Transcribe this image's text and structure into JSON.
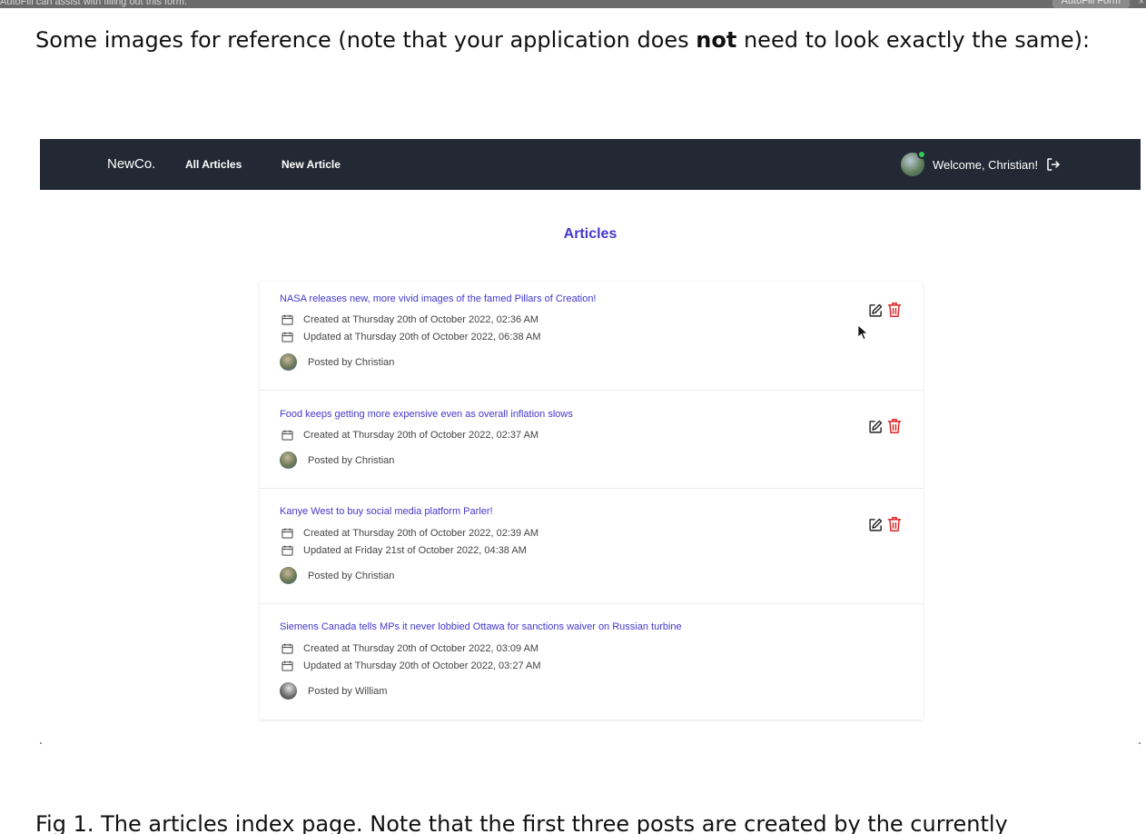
{
  "autofill": {
    "message": "AutoFill can assist with filling out this form.",
    "button_label": "AutoFill Form",
    "close_label": "×"
  },
  "document": {
    "intro_prefix": "Some images for reference (note that your application does ",
    "intro_bold": "not",
    "intro_suffix": " need to look exactly the same):",
    "caption": "Fig 1. The articles index page. Note that the first three posts are created by the currently"
  },
  "app": {
    "nav": {
      "brand": "NewCo.",
      "all_articles": "All Articles",
      "new_article": "New Article",
      "welcome": "Welcome, Christian!"
    },
    "page_title": "Articles",
    "articles": [
      {
        "title": "NASA releases new, more vivid images of the famed Pillars of Creation!",
        "created": "Created at Thursday 20th of October 2022, 02:36 AM",
        "updated": "Updated at Thursday 20th of October 2022, 06:38 AM",
        "posted_by": "Posted by Christian"
      },
      {
        "title": "Food keeps getting more expensive even as overall inflation slows",
        "created": "Created at Thursday 20th of October 2022, 02:37 AM",
        "posted_by": "Posted by Christian"
      },
      {
        "title": "Kanye West to buy social media platform Parler!",
        "created": "Created at Thursday 20th of October 2022, 02:39 AM",
        "updated": "Updated at Friday 21st of October 2022, 04:38 AM",
        "posted_by": "Posted by Christian"
      },
      {
        "title": "Siemens Canada tells MPs it never lobbied Ottawa for sanctions waiver on Russian turbine",
        "created": "Created at Thursday 20th of October 2022, 03:09 AM",
        "updated": "Updated at Thursday 20th of October 2022, 03:27 AM",
        "posted_by": "Posted by William"
      }
    ]
  },
  "colors": {
    "navbar": "#222934",
    "accent": "#4338ca",
    "delete": "#dc2626"
  }
}
